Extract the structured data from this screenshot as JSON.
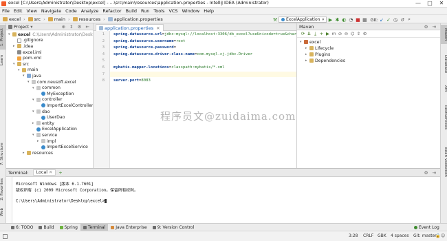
{
  "window": {
    "title": "excel [C:\\Users\\Administrator\\Desktop\\excel] - ...\\src\\main\\resources\\application.properties - IntelliJ IDEA (Administrator)",
    "minimize": "—",
    "maximize": "□",
    "close": "✕"
  },
  "menu": [
    "File",
    "Edit",
    "View",
    "Navigate",
    "Code",
    "Analyze",
    "Refactor",
    "Build",
    "Run",
    "Tools",
    "VCS",
    "Window",
    "Help"
  ],
  "breadcrumb": [
    "excel",
    "src",
    "main",
    "resources",
    "application.properties"
  ],
  "run_config": {
    "selected": "ExcelApplication",
    "git_label": "Git:"
  },
  "left_stripe": [
    "1: Project",
    "Learn",
    "7: Structure",
    "2: Favorites",
    "Web"
  ],
  "right_stripe": [
    "Maven",
    "Database",
    "Ant",
    "RestServices",
    "Bean Validation"
  ],
  "project": {
    "header": "Project",
    "items": [
      {
        "indent": 0,
        "icon": "folder",
        "arrow": "▾",
        "label": "excel",
        "hint": "C:\\Users\\Administrator\\Desktop\\excel"
      },
      {
        "indent": 1,
        "icon": "file",
        "arrow": "",
        "label": ".gitignore",
        "hint": ""
      },
      {
        "indent": 1,
        "icon": "folder",
        "arrow": "▸",
        "label": ".idea",
        "hint": ""
      },
      {
        "indent": 1,
        "icon": "iml",
        "arrow": "",
        "label": "excel.iml",
        "hint": ""
      },
      {
        "indent": 1,
        "icon": "xml",
        "arrow": "",
        "label": "pom.xml",
        "hint": ""
      },
      {
        "indent": 1,
        "icon": "folder",
        "arrow": "▾",
        "label": "src",
        "hint": ""
      },
      {
        "indent": 2,
        "icon": "folder",
        "arrow": "▾",
        "label": "main",
        "hint": ""
      },
      {
        "indent": 3,
        "icon": "src",
        "arrow": "▾",
        "label": "java",
        "hint": ""
      },
      {
        "indent": 4,
        "icon": "pkg",
        "arrow": "▾",
        "label": "com.neusoft.excel",
        "hint": ""
      },
      {
        "indent": 5,
        "icon": "pkg",
        "arrow": "▾",
        "label": "common",
        "hint": ""
      },
      {
        "indent": 6,
        "icon": "cls",
        "arrow": "",
        "label": "MyException",
        "hint": ""
      },
      {
        "indent": 5,
        "icon": "pkg",
        "arrow": "▾",
        "label": "controller",
        "hint": ""
      },
      {
        "indent": 6,
        "icon": "cls",
        "arrow": "",
        "label": "ImportExcelController",
        "hint": ""
      },
      {
        "indent": 5,
        "icon": "pkg",
        "arrow": "▾",
        "label": "dao",
        "hint": ""
      },
      {
        "indent": 6,
        "icon": "cls",
        "arrow": "",
        "label": "UserDao",
        "hint": ""
      },
      {
        "indent": 5,
        "icon": "pkg",
        "arrow": "▸",
        "label": "entity",
        "hint": ""
      },
      {
        "indent": 5,
        "icon": "cls",
        "arrow": "",
        "label": "ExcelApplication",
        "hint": ""
      },
      {
        "indent": 5,
        "icon": "pkg",
        "arrow": "▾",
        "label": "service",
        "hint": ""
      },
      {
        "indent": 6,
        "icon": "pkg",
        "arrow": "▸",
        "label": "impl",
        "hint": ""
      },
      {
        "indent": 6,
        "icon": "cls",
        "arrow": "",
        "label": "ImportExcelService",
        "hint": ""
      },
      {
        "indent": 3,
        "icon": "folder",
        "arrow": "▸",
        "label": "resources",
        "hint": ""
      }
    ]
  },
  "editor": {
    "tab": "application.properties",
    "lines": [
      {
        "n": "1",
        "key": "spring.datasource.url",
        "val": "jdbc:mysql://localhost:3306/db_excel?useUnicode=true&charact"
      },
      {
        "n": "2",
        "key": "spring.datasource.username",
        "val": "root"
      },
      {
        "n": "3",
        "key": "spring.datasource.password",
        "val": ""
      },
      {
        "n": "4",
        "key": "spring.datasource.driver-class-name",
        "val": "com.mysql.cj.jdbc.Driver"
      },
      {
        "n": "5",
        "key": "",
        "val": ""
      },
      {
        "n": "6",
        "key": "mybatis.mapper-locations",
        "val": "classpath:mybatis/*.xml"
      },
      {
        "n": "7",
        "key": "",
        "val": ""
      },
      {
        "n": "8",
        "key": "server.port",
        "val": "8083"
      }
    ],
    "watermark": "程序员文@zuidaima.com"
  },
  "maven": {
    "header": "Maven",
    "tree": [
      {
        "indent": 0,
        "arrow": "▾",
        "label": "excel"
      },
      {
        "indent": 1,
        "arrow": "▸",
        "label": "Lifecycle"
      },
      {
        "indent": 1,
        "arrow": "▸",
        "label": "Plugins"
      },
      {
        "indent": 1,
        "arrow": "▸",
        "label": "Dependencies"
      }
    ]
  },
  "terminal": {
    "header": "Terminal:",
    "tab": "Local",
    "lines": [
      "Microsoft Windows [版本 6.1.7601]",
      "版权所有 (c) 2009 Microsoft Corporation。保留所有权利。",
      "",
      "C:\\Users\\Administrator\\Desktop\\excel>"
    ]
  },
  "tool_windows": [
    "6: TODO",
    "Build",
    "Spring",
    "Terminal",
    "Java Enterprise",
    "9: Version Control"
  ],
  "event_log": "Event Log",
  "status": {
    "position": "3:28",
    "line_sep": "CRLF",
    "encoding": "GBK",
    "indent": "4 spaces",
    "branch": "Git: master"
  }
}
